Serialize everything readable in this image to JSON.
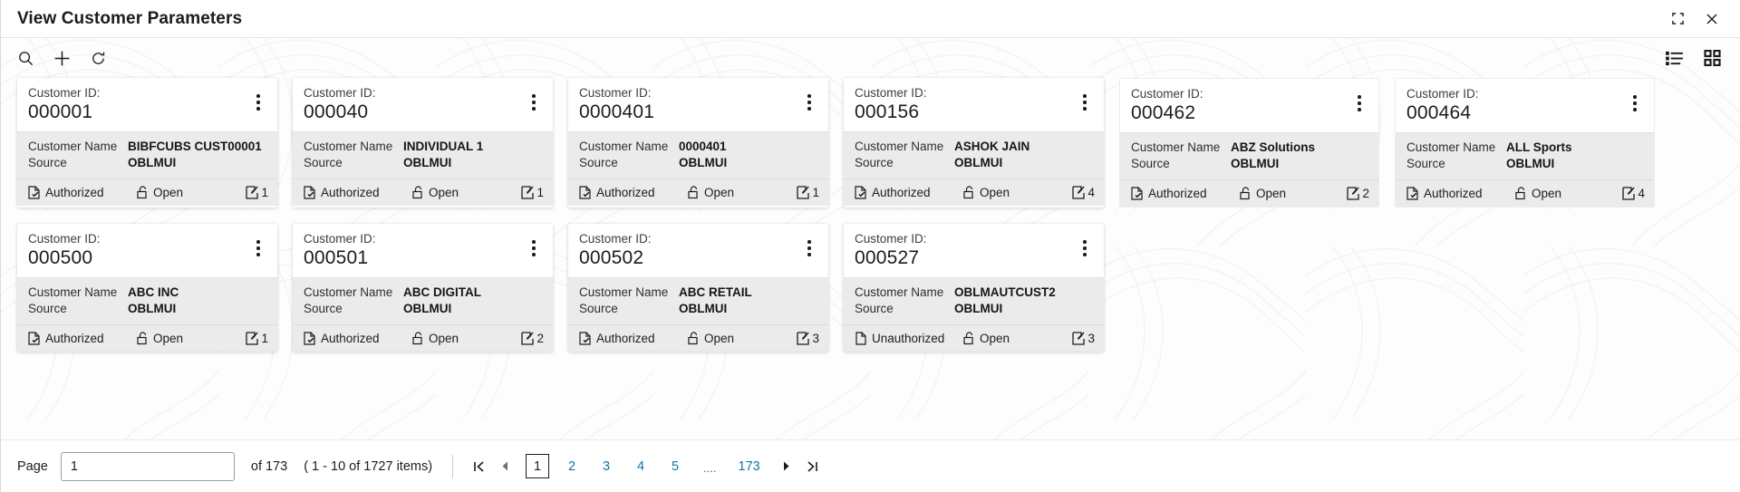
{
  "window": {
    "title": "View Customer Parameters",
    "controls": [
      {
        "name": "restore-icon",
        "label": "Restore"
      },
      {
        "name": "close-icon",
        "label": "Close"
      }
    ]
  },
  "toolbar": {
    "actions": [
      {
        "name": "search-icon",
        "label": "Search"
      },
      {
        "name": "add-icon",
        "label": "Add"
      },
      {
        "name": "refresh-icon",
        "label": "Refresh"
      }
    ],
    "views": [
      {
        "name": "list-view-icon",
        "label": "List view"
      },
      {
        "name": "grid-view-icon",
        "label": "Grid view"
      }
    ]
  },
  "card_labels": {
    "customer_id": "Customer ID:",
    "customer_name": "Customer Name",
    "source": "Source"
  },
  "cards": [
    {
      "id": "000001",
      "name": "BIBFCUBS CUST00001",
      "source": "OBLMUI",
      "status": "Authorized",
      "lock": "Open",
      "edits": "1",
      "flat": false
    },
    {
      "id": "000040",
      "name": "INDIVIDUAL 1",
      "source": "OBLMUI",
      "status": "Authorized",
      "lock": "Open",
      "edits": "1",
      "flat": false
    },
    {
      "id": "0000401",
      "name": "0000401",
      "source": "OBLMUI",
      "status": "Authorized",
      "lock": "Open",
      "edits": "1",
      "flat": false
    },
    {
      "id": "000156",
      "name": "ASHOK JAIN",
      "source": "OBLMUI",
      "status": "Authorized",
      "lock": "Open",
      "edits": "4",
      "flat": false
    },
    {
      "id": "000462",
      "name": "ABZ Solutions",
      "source": "OBLMUI",
      "status": "Authorized",
      "lock": "Open",
      "edits": "2",
      "flat": true
    },
    {
      "id": "000464",
      "name": "ALL Sports",
      "source": "OBLMUI",
      "status": "Authorized",
      "lock": "Open",
      "edits": "4",
      "flat": true
    },
    {
      "id": "000500",
      "name": "ABC INC",
      "source": "OBLMUI",
      "status": "Authorized",
      "lock": "Open",
      "edits": "1",
      "flat": false
    },
    {
      "id": "000501",
      "name": "ABC DIGITAL",
      "source": "OBLMUI",
      "status": "Authorized",
      "lock": "Open",
      "edits": "2",
      "flat": false
    },
    {
      "id": "000502",
      "name": "ABC RETAIL",
      "source": "OBLMUI",
      "status": "Authorized",
      "lock": "Open",
      "edits": "3",
      "flat": false
    },
    {
      "id": "000527",
      "name": "OBLMAUTCUST2",
      "source": "OBLMUI",
      "status": "Unauthorized",
      "lock": "Open",
      "edits": "3",
      "flat": false
    }
  ],
  "pagination": {
    "page_label": "Page",
    "page_value": "1",
    "total_pages_label": "of 173",
    "items_label": "( 1 - 10 of 1727 items)",
    "first_icon": "first-page-icon",
    "prev_icon": "previous-page-icon",
    "next_icon": "next-page-icon",
    "last_icon": "last-page-icon",
    "pages": [
      "1",
      "2",
      "3",
      "4",
      "5"
    ],
    "ellipsis": "....",
    "last_page": "173",
    "current_page": "1"
  },
  "colors": {
    "link": "#1175a8",
    "card_body": "#ebebeb",
    "text": "#1c1c1c"
  }
}
